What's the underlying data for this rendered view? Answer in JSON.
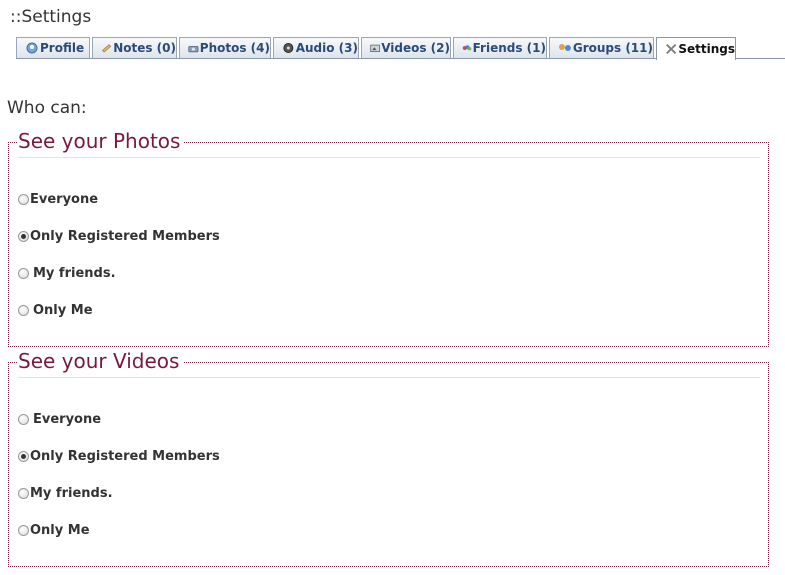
{
  "page": {
    "title": "::Settings"
  },
  "tabs": [
    {
      "label": "Profile",
      "icon": "profile-icon"
    },
    {
      "label": "Notes (0)",
      "icon": "notes-icon"
    },
    {
      "label": "Photos (4)",
      "icon": "photos-icon"
    },
    {
      "label": "Audio (3)",
      "icon": "audio-icon"
    },
    {
      "label": "Videos (2)",
      "icon": "videos-icon"
    },
    {
      "label": "Friends (1)",
      "icon": "friends-icon"
    },
    {
      "label": "Groups (11)",
      "icon": "groups-icon"
    },
    {
      "label": "Settings",
      "icon": "settings-icon",
      "active": true
    }
  ],
  "who_can": "Who can:",
  "photos_group": {
    "legend": "See your Photos",
    "options": [
      "Everyone",
      "Only Registered Members",
      "My friends.",
      "Only Me"
    ],
    "selected": "Only Registered Members"
  },
  "videos_group": {
    "legend": "See your Videos",
    "options": [
      "Everyone",
      "Only Registered Members",
      "My friends.",
      "Only Me"
    ],
    "selected": "Only Registered Members"
  },
  "colors": {
    "legend": "#7a1a39",
    "fieldset_border": "#7d1f3a",
    "tab_text": "#2b4b77"
  }
}
